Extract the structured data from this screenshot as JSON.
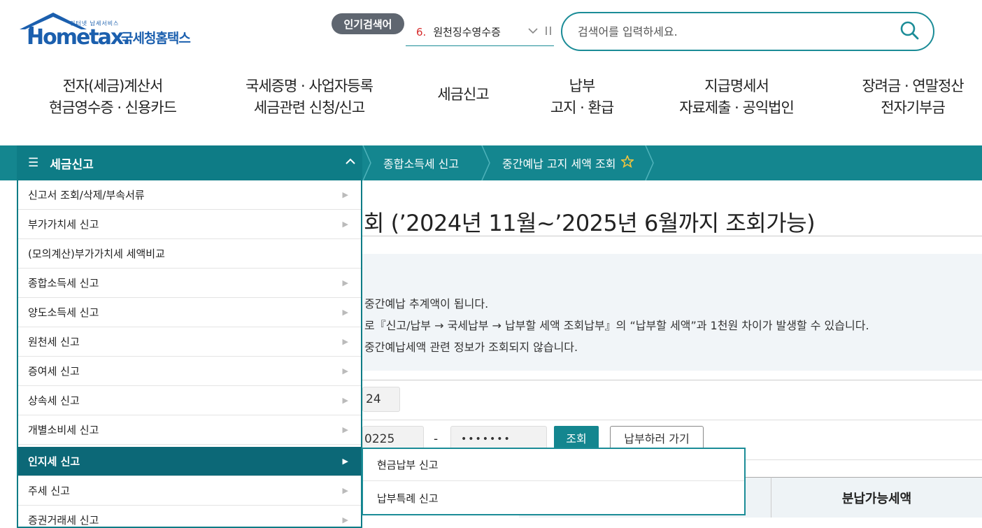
{
  "header": {
    "logo_small": "인터넷 납세서비스",
    "logo_main": "Hometax.",
    "logo_kr": "국세청홈택스",
    "popular_badge": "인기검색어",
    "popular_rank": "6.",
    "popular_term": "원천징수영수증",
    "search_placeholder": "검색어를 입력하세요."
  },
  "gnb": [
    {
      "line1": "전자(세금)계산서",
      "line2": "현금영수증 · 신용카드"
    },
    {
      "line1": "국세증명 · 사업자등록",
      "line2": "세금관련 신청/신고"
    },
    {
      "line1": "세금신고",
      "line2": ""
    },
    {
      "line1": "납부",
      "line2": "고지 · 환급"
    },
    {
      "line1": "지급명세서",
      "line2": "자료제출 · 공익법인"
    },
    {
      "line1": "장려금 · 연말정산",
      "line2": "전자기부금"
    }
  ],
  "location": {
    "menu_title": "세금신고",
    "crumb1": "종합소득세 신고",
    "crumb2": "중간예납 고지 세액 조회"
  },
  "left_menu": [
    {
      "label": "신고서 조회/삭제/부속서류",
      "arrow": true
    },
    {
      "label": "부가가치세 신고",
      "arrow": true
    },
    {
      "label": "(모의계산)부가가치세 세액비교",
      "arrow": false
    },
    {
      "label": "종합소득세 신고",
      "arrow": true
    },
    {
      "label": "양도소득세 신고",
      "arrow": true
    },
    {
      "label": "원천세 신고",
      "arrow": true
    },
    {
      "label": "증여세 신고",
      "arrow": true
    },
    {
      "label": "상속세 신고",
      "arrow": true
    },
    {
      "label": "개별소비세 신고",
      "arrow": true
    },
    {
      "label": "인지세 신고",
      "arrow": true,
      "active": true
    },
    {
      "label": "주세 신고",
      "arrow": true
    },
    {
      "label": "증권거래세 신고",
      "arrow": true
    }
  ],
  "submenu": [
    "현금납부 신고",
    "납부특례 신고"
  ],
  "content": {
    "title": "회 (’2024년 11월~’2025년 6월까지 조회가능)",
    "notice1": "중간예납 추계액이 됩니다.",
    "notice2": "로『신고/납부 → 국세납부 → 납부할 세액 조회납부』의 “납부할 세액”과 1천원 차이가 발생할 수 있습니다.",
    "notice3": "중간예납세액 관련 정보가 조회되지 않습니다.",
    "year_value": "24",
    "id_front": "0225",
    "id_dash": "-",
    "id_back": "•••••••",
    "query_button": "조회",
    "pay_button": "납부하러 가기",
    "table_header": "분납가능세액"
  },
  "colors": {
    "accent": "#14868f",
    "active": "#0c6877",
    "logo": "#1b5fae"
  },
  "icons": [
    "house-logo-icon",
    "chevron-down-icon",
    "pause-icon",
    "search-icon",
    "menu-icon",
    "chevron-up-icon",
    "star-icon",
    "chevron-right-icon"
  ]
}
